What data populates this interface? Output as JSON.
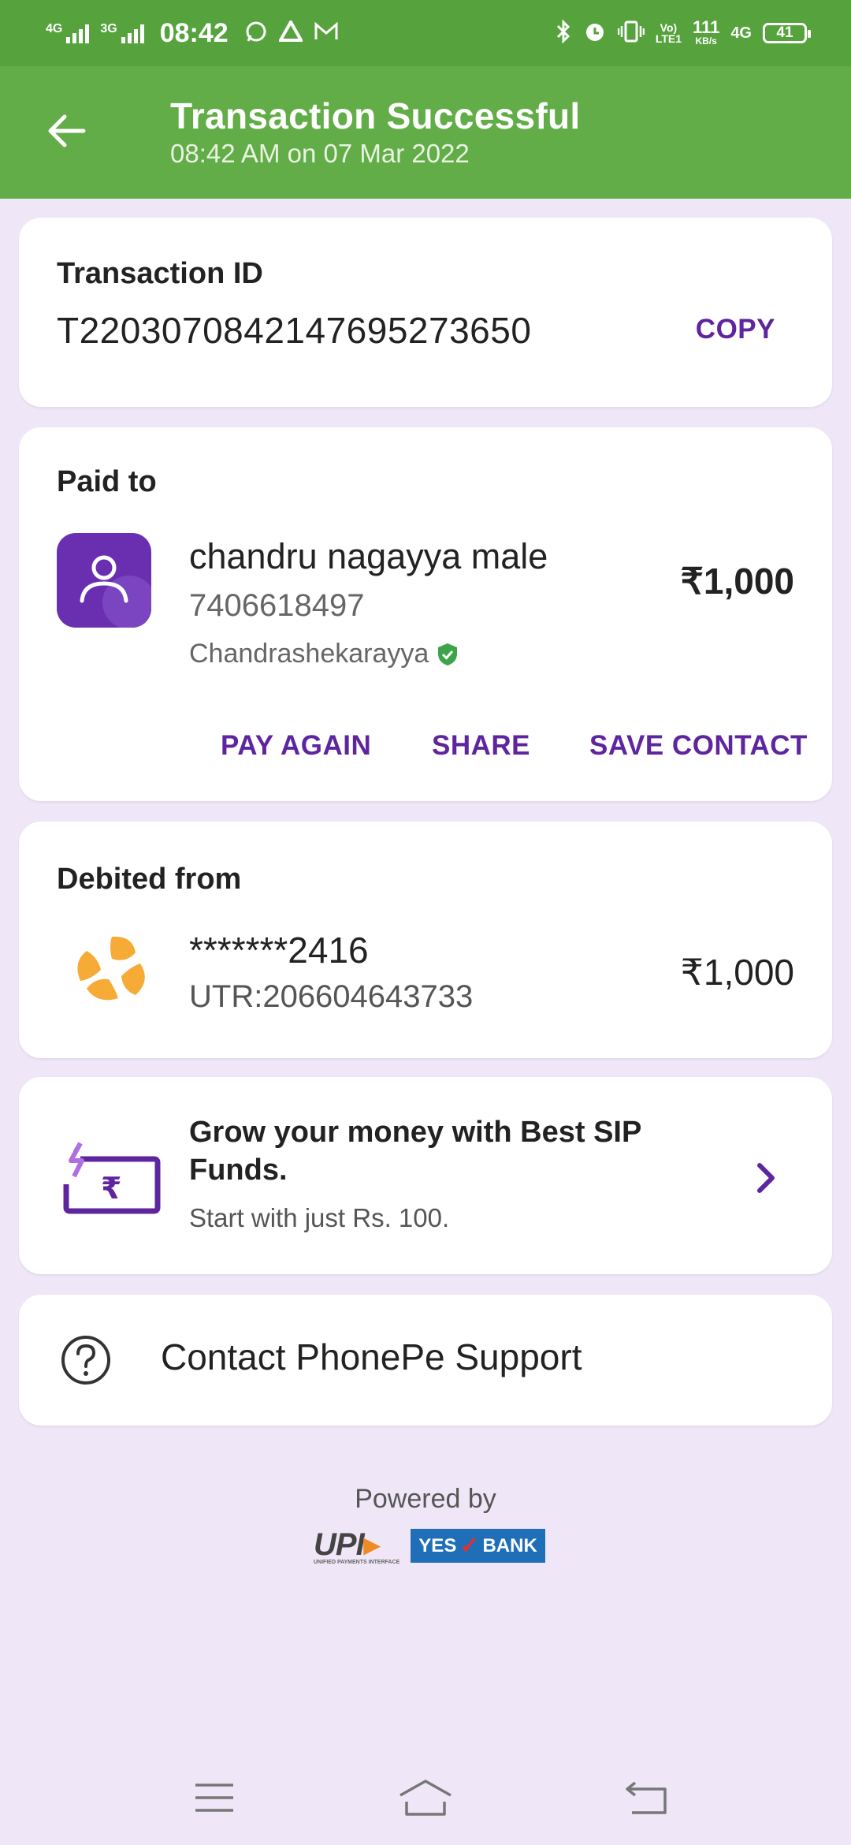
{
  "status_bar": {
    "net1": "4G",
    "net2": "3G",
    "time": "08:42",
    "speed": "111",
    "speed_unit": "KB/s",
    "volte": "Vo)\nLTE1",
    "net4g": "4G",
    "battery": "41"
  },
  "header": {
    "title": "Transaction Successful",
    "subtitle": "08:42 AM on 07 Mar 2022",
    "color": "#62ad47"
  },
  "transaction": {
    "label": "Transaction ID",
    "id": "T2203070842147695273650",
    "copy_label": "COPY"
  },
  "paid_to": {
    "label": "Paid to",
    "name": "chandru nagayya male",
    "phone": "7406618497",
    "bank_name": "Chandrashekarayya",
    "amount": "₹1,000",
    "actions": [
      "PAY AGAIN",
      "SHARE",
      "SAVE CONTACT"
    ]
  },
  "debited_from": {
    "label": "Debited from",
    "account": "*******2416",
    "utr": "UTR:206604643733",
    "amount": "₹1,000"
  },
  "promo": {
    "title": "Grow your money with Best SIP Funds.",
    "subtitle": "Start with just Rs. 100."
  },
  "support": {
    "label": "Contact PhonePe Support"
  },
  "footer": {
    "powered_by": "Powered by",
    "upi_logo_text": "UPI",
    "upi_tagline": "UNIFIED PAYMENTS INTERFACE",
    "bank_yes": "YES",
    "bank_name": "BANK"
  },
  "icons": {
    "back": "arrow-left-icon",
    "avatar": "person-icon",
    "verified": "shield-check-icon",
    "bank": "icici-logo-icon",
    "sip": "rupee-card-icon",
    "chevron": "chevron-right-icon",
    "help": "question-circle-icon"
  },
  "colors": {
    "accent": "#5f259f",
    "background": "#efe7f7",
    "verified": "#3ea44c",
    "bank_logo": "#f5ab35"
  }
}
